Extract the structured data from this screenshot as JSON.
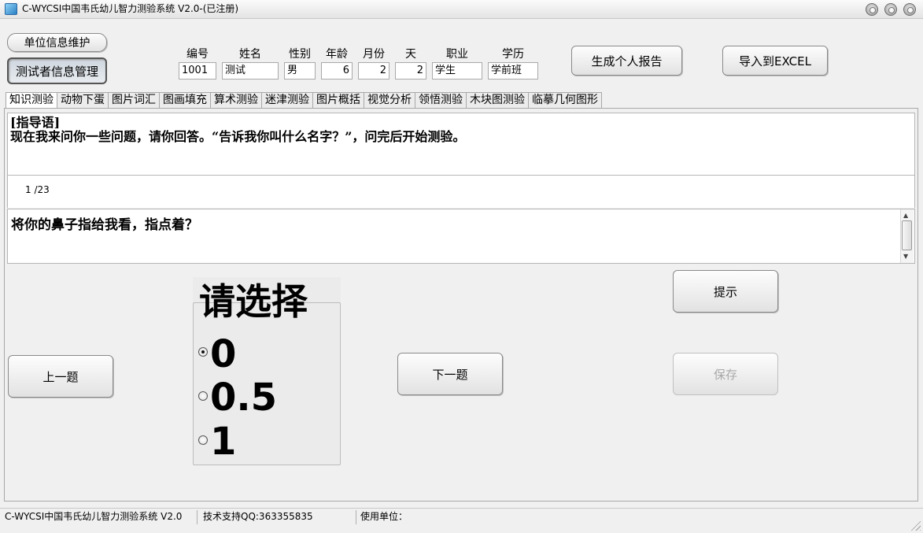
{
  "window": {
    "title": "C-WYCSI中国韦氏幼儿智力测验系统 V2.0-(已注册)"
  },
  "top_buttons": {
    "unit_info": "单位信息维护",
    "tester_info": "测试者信息管理",
    "generate_report": "生成个人报告",
    "export_excel": "导入到EXCEL"
  },
  "form": {
    "labels": {
      "id": "编号",
      "name": "姓名",
      "gender": "性别",
      "age": "年龄",
      "month": "月份",
      "day": "天",
      "occupation": "职业",
      "education": "学历"
    },
    "values": {
      "id": "1001",
      "name": "测试",
      "gender": "男",
      "age": "6",
      "month": "2",
      "day": "2",
      "occupation": "学生",
      "education": "学前班"
    }
  },
  "tabs": [
    {
      "label": "知识测验",
      "active": true
    },
    {
      "label": "动物下蛋",
      "active": false
    },
    {
      "label": "图片词汇",
      "active": false
    },
    {
      "label": "图画填充",
      "active": false
    },
    {
      "label": "算术测验",
      "active": false
    },
    {
      "label": "迷津测验",
      "active": false
    },
    {
      "label": "图片概括",
      "active": false
    },
    {
      "label": "视觉分析",
      "active": false
    },
    {
      "label": "领悟测验",
      "active": false
    },
    {
      "label": "木块图测验",
      "active": false
    },
    {
      "label": "临摹几何图形",
      "active": false
    }
  ],
  "test": {
    "guide_heading": "[指导语]",
    "guide_text": "现在我来问你一些问题，请你回答。“告诉我你叫什么名字？”，问完后开始测验。",
    "counter": "1 /23",
    "question": "将你的鼻子指给我看，指点着？",
    "choice_title": "请选择",
    "options": [
      {
        "label": "0",
        "selected": true
      },
      {
        "label": "0.5",
        "selected": false
      },
      {
        "label": "1",
        "selected": false
      }
    ],
    "buttons": {
      "hint": "提示",
      "prev": "上一题",
      "next": "下一题",
      "save": "保存"
    }
  },
  "status": {
    "app": "C-WYCSI中国韦氏幼儿智力测验系统 V2.0",
    "support": "技术支持QQ:363355835",
    "unit": "使用单位："
  }
}
